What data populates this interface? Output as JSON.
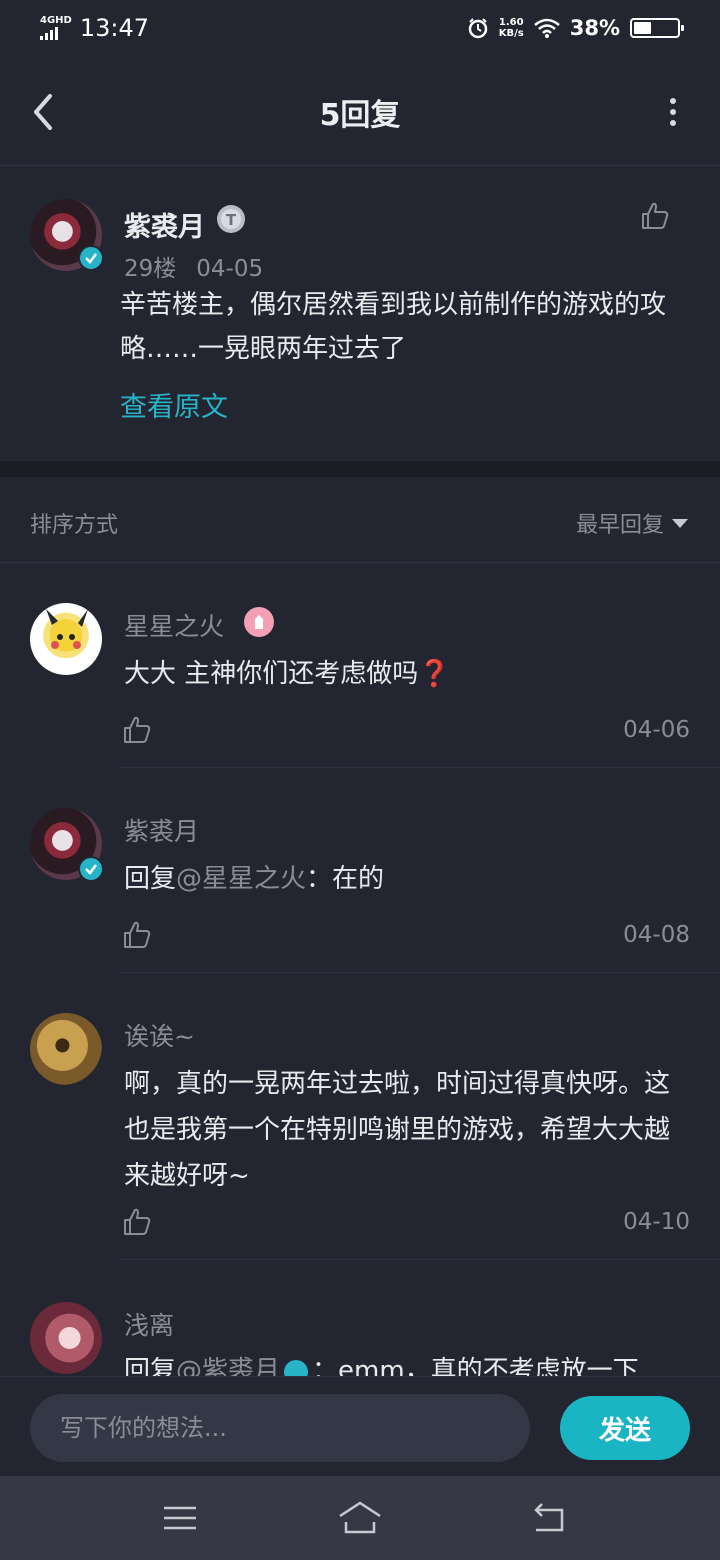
{
  "status_bar": {
    "network": "4G",
    "network_sub": "HD",
    "time": "13:47",
    "speed_value": "1.60",
    "speed_unit": "KB/s",
    "battery": "38%",
    "battery_level": 0.38
  },
  "header": {
    "title": "5回复",
    "back_icon": "chevron-left-icon",
    "more_icon": "more-vertical-icon"
  },
  "main_post": {
    "author": "紫裘月",
    "floor": "29楼",
    "date": "04-05",
    "text": "辛苦楼主，偶尔居然看到我以前制作的游戏的攻略……一晃眼两年过去了",
    "view_original": "查看原文",
    "level_badge": "T"
  },
  "sort": {
    "label": "排序方式",
    "value": "最早回复"
  },
  "replies": [
    {
      "author": "星星之火",
      "text": "大大 主神你们还考虑做吗",
      "emoji": "❓",
      "date": "04-06"
    },
    {
      "author": "紫裘月",
      "prefix": "回复",
      "mention": "@星星之火",
      "text": "：在的",
      "date": "04-08"
    },
    {
      "author": "诶诶~",
      "text": "啊，真的一晃两年过去啦，时间过得真快呀。这也是我第一个在特别鸣谢里的游戏，希望大大越来越好呀~",
      "date": "04-10"
    },
    {
      "author": "浅离",
      "prefix": "回复",
      "mention": "@紫裘月",
      "text": "：emm，真的不考虑放一下"
    }
  ],
  "composer": {
    "placeholder": "写下你的想法...",
    "send_label": "发送"
  },
  "colors": {
    "background": "#232530",
    "accent": "#1ab5c4",
    "muted_text": "#8a8d98",
    "primary_text": "#e9eaee"
  }
}
